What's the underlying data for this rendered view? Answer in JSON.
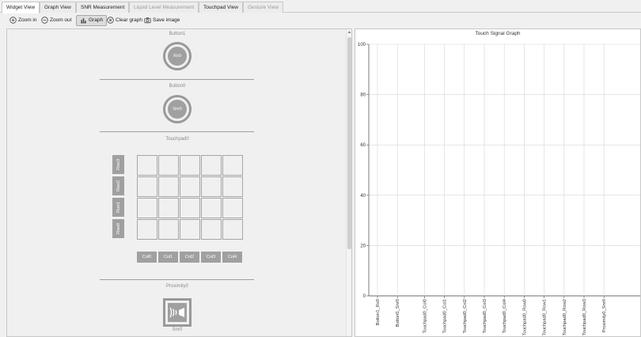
{
  "tabs": [
    {
      "label": "Widget View",
      "state": "active"
    },
    {
      "label": "Graph View",
      "state": "normal"
    },
    {
      "label": "SNR Measurement",
      "state": "normal"
    },
    {
      "label": "Liquid Level Measurement",
      "state": "disabled"
    },
    {
      "label": "Touchpad View",
      "state": "normal"
    },
    {
      "label": "Gesture View",
      "state": "disabled"
    }
  ],
  "toolbar": {
    "zoom_in": "Zoom in",
    "zoom_out": "Zoom out",
    "graph": "Graph",
    "clear_graph": "Clear graph",
    "save_image": "Save image"
  },
  "widgets": {
    "button1": {
      "title": "Button1",
      "sensor": "Rx0"
    },
    "button0": {
      "title": "Button0",
      "sensor": "Snr0"
    },
    "touchpad0": {
      "title": "Touchpad0",
      "rows": [
        "Row3",
        "Row2",
        "Row1",
        "Row0"
      ],
      "cols": [
        "Col0",
        "Col1",
        "Col2",
        "Col3",
        "Col4"
      ]
    },
    "proximity0": {
      "title": "Proximity0",
      "sensor": "Snr0"
    }
  },
  "chart_data": {
    "type": "bar",
    "title": "Touch Signal Graph",
    "categories": [
      "Button1_Rx0",
      "Button0_Snr0",
      "Touchpad0_Col0",
      "Touchpad0_Col1",
      "Touchpad0_Col2",
      "Touchpad0_Col3",
      "Touchpad0_Col4",
      "Touchpad0_Row0",
      "Touchpad0_Row1",
      "Touchpad0_Row2",
      "Touchpad0_Row3",
      "Proximity0_Snr0"
    ],
    "values": [
      0,
      0,
      0,
      0,
      0,
      0,
      0,
      0,
      0,
      0,
      0,
      0
    ],
    "ylim": [
      0,
      100
    ],
    "yticks": [
      0,
      20,
      40,
      60,
      80,
      100
    ],
    "grid": true,
    "xlabel": "",
    "ylabel": ""
  }
}
